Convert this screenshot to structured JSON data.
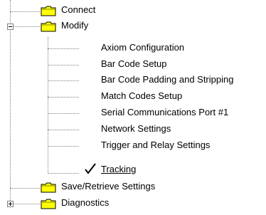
{
  "tree": {
    "items": [
      {
        "label": "Connect",
        "icon": "folder-icon",
        "expander": null
      },
      {
        "label": "Modify",
        "icon": "folder-icon",
        "expander": "minus"
      },
      {
        "label": "Axiom Configuration"
      },
      {
        "label": "Bar Code Setup"
      },
      {
        "label": "Bar Code Padding and Stripping"
      },
      {
        "label": "Match Codes Setup"
      },
      {
        "label": "Serial Communications Port #1"
      },
      {
        "label": "Network Settings"
      },
      {
        "label": "Trigger and Relay Settings"
      },
      {
        "label": "Tracking",
        "icon": "checkmark-icon",
        "selected": true
      },
      {
        "label": "Save/Retrieve Settings",
        "icon": "folder-icon",
        "expander": null
      },
      {
        "label": "Diagnostics",
        "icon": "folder-icon",
        "expander": "plus"
      }
    ]
  },
  "colors": {
    "folder_fill": "#ffff00",
    "folder_outline": "#000000",
    "connector": "#808080"
  }
}
